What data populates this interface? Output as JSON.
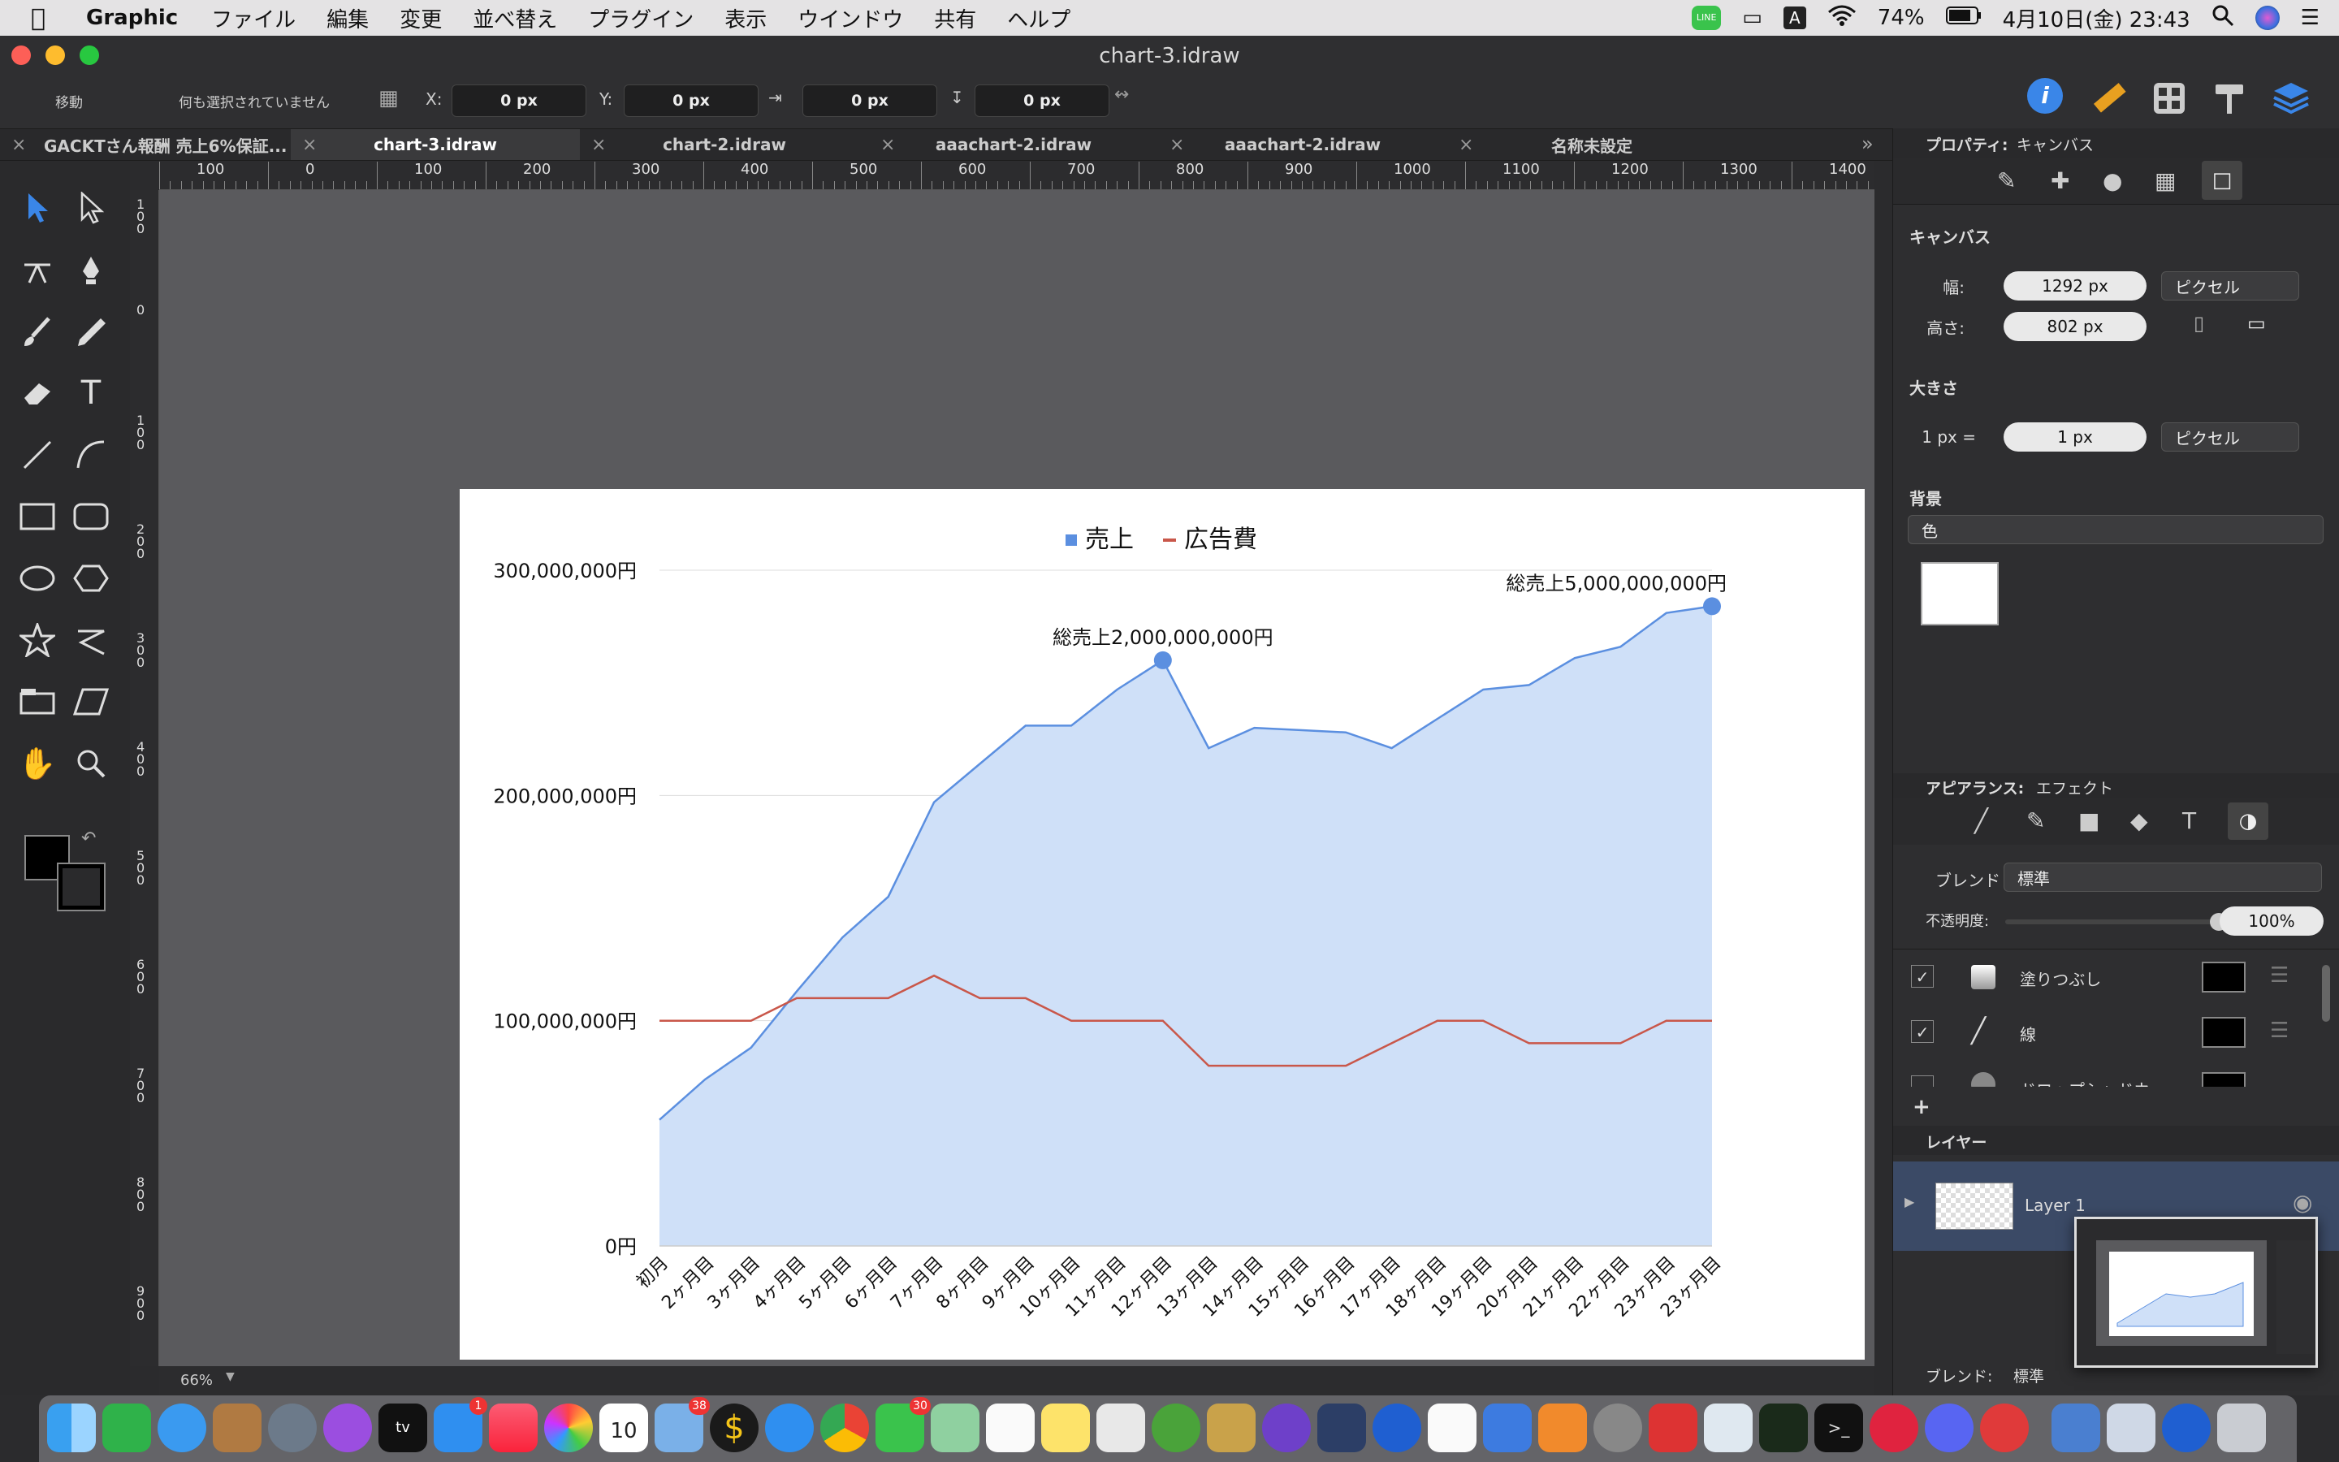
{
  "menubar": {
    "app_name": "Graphic",
    "items": [
      "ファイル",
      "編集",
      "変更",
      "並べ替え",
      "プラグイン",
      "表示",
      "ウインドウ",
      "共有",
      "ヘルプ"
    ],
    "battery": "74%",
    "clock": "4月10日(金)  23:43",
    "line_badge": "LINE",
    "input_mode": "A"
  },
  "window": {
    "title": "chart-3.idraw"
  },
  "toolbar": {
    "tool_name": "移動",
    "selection_status": "何も選択されていません",
    "x_label": "X:",
    "x_value": "0 px",
    "y_label": "Y:",
    "y_value": "0 px",
    "w_value": "0 px",
    "h_value": "0 px"
  },
  "tabs": [
    {
      "label": "GACKTさん報酬 売上6%保証...",
      "active": false
    },
    {
      "label": "chart-3.idraw",
      "active": true
    },
    {
      "label": "chart-2.idraw",
      "active": false
    },
    {
      "label": "aaachart-2.idraw",
      "active": false
    },
    {
      "label": "aaachart-2.idraw",
      "active": false
    },
    {
      "label": "名称未設定",
      "active": false
    }
  ],
  "ruler_h": [
    "100",
    "0",
    "100",
    "200",
    "300",
    "400",
    "500",
    "600",
    "700",
    "800",
    "900",
    "1000",
    "1100",
    "1200",
    "1300",
    "1400"
  ],
  "ruler_v": [
    "100",
    "0",
    "100",
    "200",
    "300",
    "400",
    "500",
    "600",
    "700",
    "800",
    "900"
  ],
  "status": {
    "zoom": "66%"
  },
  "inspector": {
    "header": "プロパティ:",
    "header_value": "キャンバス",
    "canvas_section": "キャンバス",
    "width_label": "幅:",
    "width_value": "1292 px",
    "width_unit": "ピクセル",
    "height_label": "高さ:",
    "height_value": "802 px",
    "size_section": "大きさ",
    "px_label": "1 px =",
    "px_value": "1 px",
    "px_unit": "ピクセル",
    "bg_section": "背景",
    "bg_mode": "色",
    "bg_color": "#ffffff",
    "appearance_header": "アピアランス:",
    "appearance_value": "エフェクト",
    "blend_label": "ブレンド",
    "blend_value": "標準",
    "opacity_label": "不透明度:",
    "opacity_value": "100%",
    "effects": [
      {
        "label": "塗りつぶし",
        "checked": true
      },
      {
        "label": "線",
        "checked": true
      },
      {
        "label": "ドロップシャドウ",
        "checked": false
      }
    ],
    "layers_header": "レイヤー",
    "layer_name": "Layer 1",
    "bottom_blend_label": "ブレンド:",
    "bottom_blend_value": "標準"
  },
  "chart_data": {
    "type": "area",
    "legend": [
      "売上",
      "広告費"
    ],
    "legend_position": "top-center",
    "categories": [
      "初月",
      "2ヶ月目",
      "3ヶ月目",
      "4ヶ月目",
      "5ヶ月目",
      "6ヶ月目",
      "7ヶ月目",
      "8ヶ月目",
      "9ヶ月目",
      "10ヶ月目",
      "11ヶ月目",
      "12ヶ月目",
      "13ヶ月目",
      "14ヶ月目",
      "15ヶ月目",
      "16ヶ月目",
      "17ヶ月目",
      "18ヶ月目",
      "19ヶ月目",
      "20ヶ月目",
      "21ヶ月目",
      "22ヶ月目",
      "23ヶ月目",
      "23ヶ月目"
    ],
    "yticks": [
      "0円",
      "100,000,000円",
      "200,000,000円",
      "300,000,000円"
    ],
    "ylim": [
      0,
      300000000
    ],
    "grid": true,
    "series": [
      {
        "name": "売上",
        "color": "#5b8fe0",
        "fill": "#cfe0f8",
        "values": [
          56000000,
          74000000,
          88000000,
          113000000,
          137000000,
          155000000,
          197000000,
          214000000,
          231000000,
          231000000,
          247000000,
          260000000,
          221000000,
          230000000,
          229000000,
          228000000,
          221000000,
          234000000,
          247000000,
          249000000,
          261000000,
          266000000,
          281000000,
          284000000
        ]
      },
      {
        "name": "広告費",
        "color": "#c9574a",
        "values": [
          100000000,
          100000000,
          100000000,
          110000000,
          110000000,
          110000000,
          120000000,
          110000000,
          110000000,
          100000000,
          100000000,
          100000000,
          80000000,
          80000000,
          80000000,
          80000000,
          90000000,
          100000000,
          100000000,
          90000000,
          90000000,
          90000000,
          100000000,
          100000000
        ]
      }
    ],
    "annotations": [
      {
        "text": "総売上2,000,000,000円",
        "index": 11
      },
      {
        "text": "総売上5,000,000,000円",
        "index": 23
      }
    ]
  },
  "dock": {
    "badge_appstore": "1",
    "badge_mail": "38",
    "badge_line": "30",
    "calendar_day": "10"
  }
}
